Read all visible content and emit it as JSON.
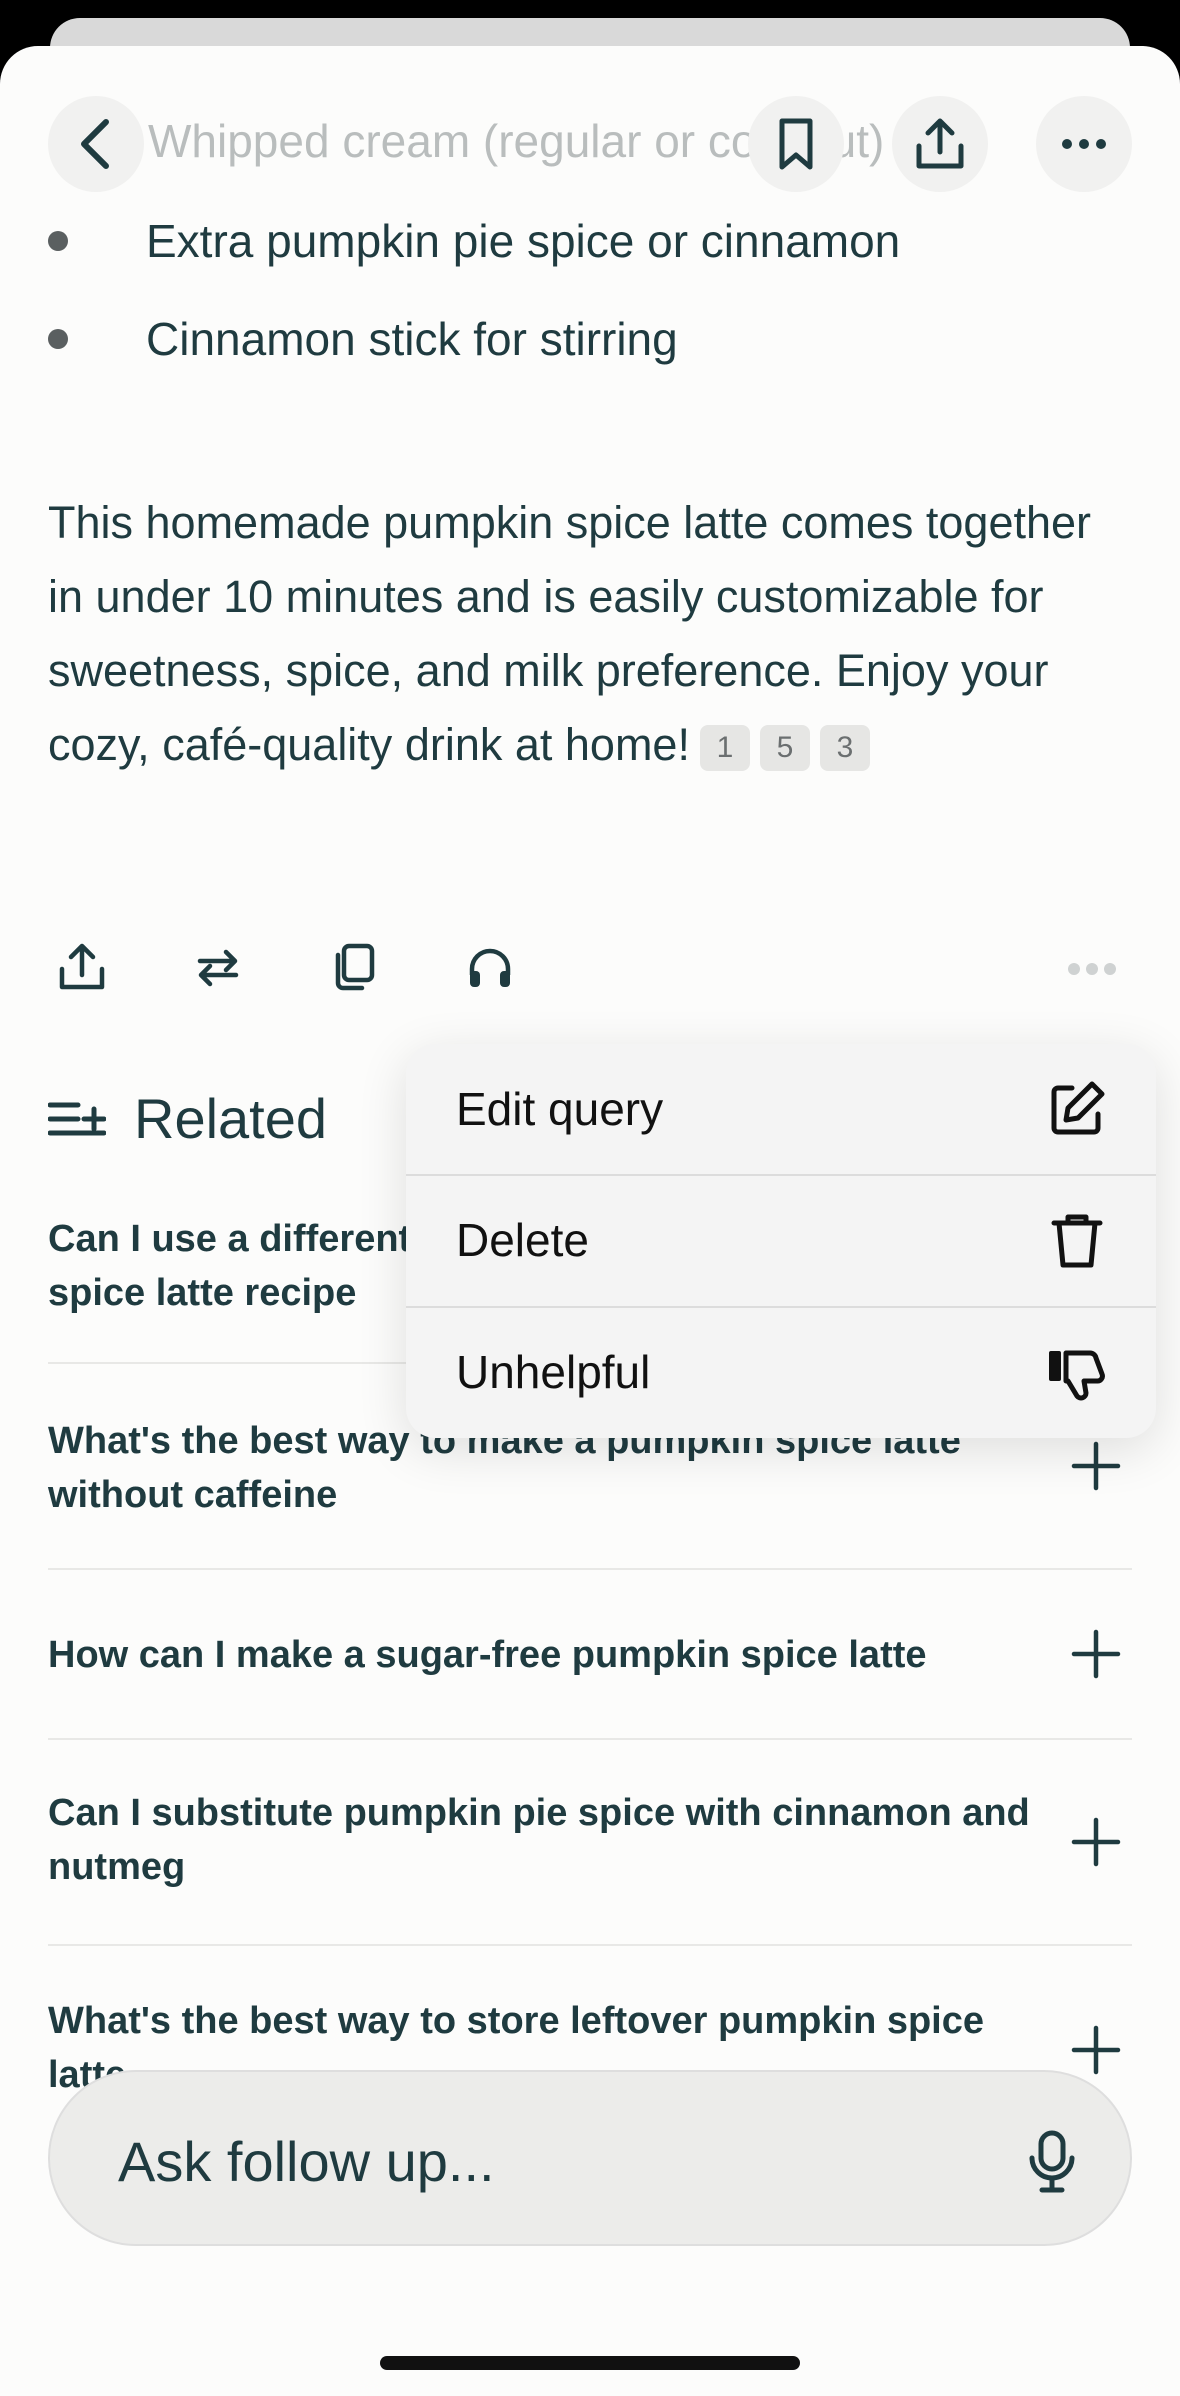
{
  "header": {
    "faded_text": "Whipped cream (regular or coconut)",
    "back_icon": "chevron-left-icon",
    "bookmark_icon": "bookmark-icon",
    "share_icon": "share-icon",
    "more_icon": "ellipsis-icon"
  },
  "answer": {
    "bullets": [
      "Extra pumpkin pie spice or cinnamon",
      "Cinnamon stick for stirring"
    ],
    "paragraph": "This homemade pumpkin spice latte comes together in under 10 minutes and is easily customizable for sweetness, spice, and milk preference. Enjoy your cozy, café-quality drink at home!",
    "citations": [
      "1",
      "5",
      "3"
    ]
  },
  "actions": {
    "icons": [
      "share-icon",
      "rewrite-icon",
      "copy-icon",
      "headphones-icon"
    ],
    "more_icon": "ellipsis-icon"
  },
  "related": {
    "heading": "Related",
    "items": [
      "Can I use a different type of milk for this pumpkin spice latte recipe",
      "What's the best way to make a pumpkin spice latte without caffeine",
      "How can I make a sugar-free pumpkin spice latte",
      "Can I substitute pumpkin pie spice with cinnamon and nutmeg",
      "What's the best way to store leftover pumpkin spice latte"
    ]
  },
  "menu": {
    "items": [
      {
        "label": "Edit query",
        "icon": "edit-icon"
      },
      {
        "label": "Delete",
        "icon": "trash-icon"
      },
      {
        "label": "Unhelpful",
        "icon": "thumbs-down-icon"
      }
    ]
  },
  "followup": {
    "placeholder": "Ask follow up...",
    "mic_icon": "microphone-icon"
  },
  "colors": {
    "text": "#1f3b40",
    "background": "#fcfcfb",
    "menu_bg": "#f4f4f4"
  }
}
